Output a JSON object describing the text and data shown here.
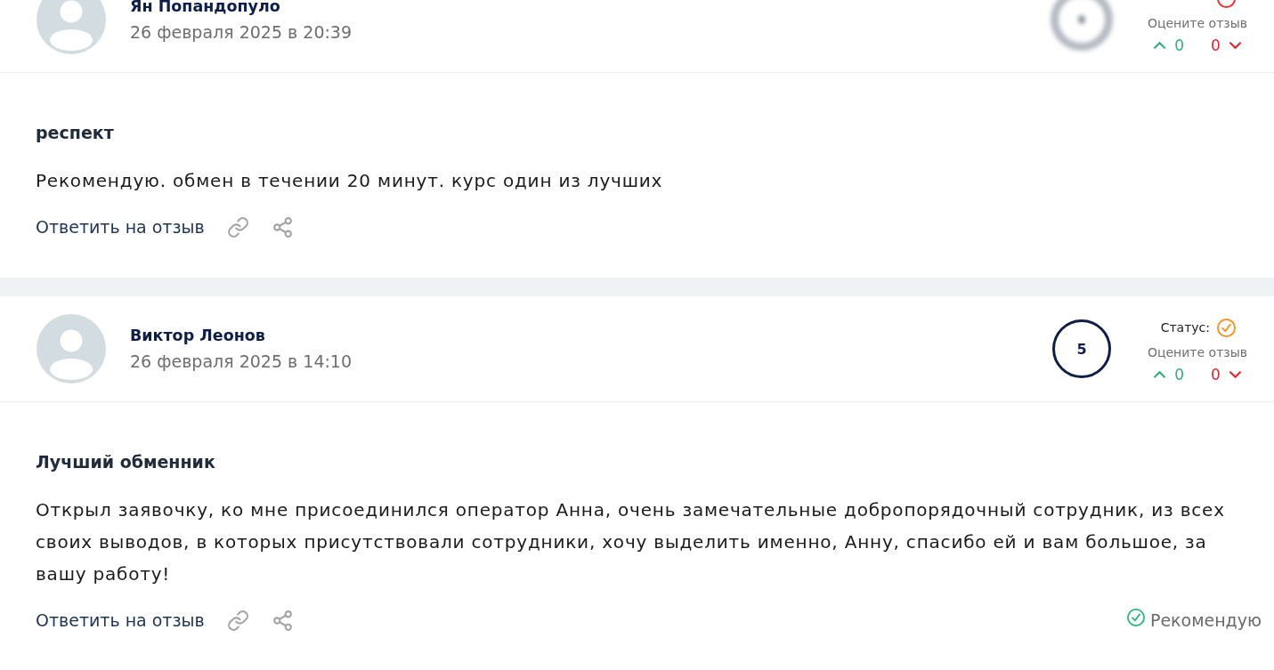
{
  "reviews": [
    {
      "author": "Ян Попандопуло",
      "date": "26 февраля 2025 в 20:39",
      "rating": {
        "kind": "blurred"
      },
      "status": {
        "kind": "ring",
        "color": "#e8302f"
      },
      "vote_prompt": "Оцените отзыв",
      "upvotes": "0",
      "downvotes": "0",
      "title": "респект",
      "text": "Рекомендую. обмен в течении 20 минут. курс один из лучших",
      "reply_link": "Ответить на отзыв"
    },
    {
      "author": "Виктор Леонов",
      "date": "26 февраля 2025 в 14:10",
      "rating": {
        "kind": "score",
        "value": "5"
      },
      "status": {
        "kind": "check",
        "label": "Статус:",
        "color": "#f0962a"
      },
      "vote_prompt": "Оцените отзыв",
      "upvotes": "0",
      "downvotes": "0",
      "title": "Лучший обменник",
      "text": "Открыл заявочку, ко мне присоединился оператор Анна, очень замечательные добропорядочный сотрудник, из всех своих выводов, в которых присутствовали сотрудники, хочу выделить именно, Анну, спасибо ей и вам большое, за вашу работу!",
      "reply_link": "Ответить на отзыв",
      "recommendation": "Рекомендую"
    }
  ]
}
